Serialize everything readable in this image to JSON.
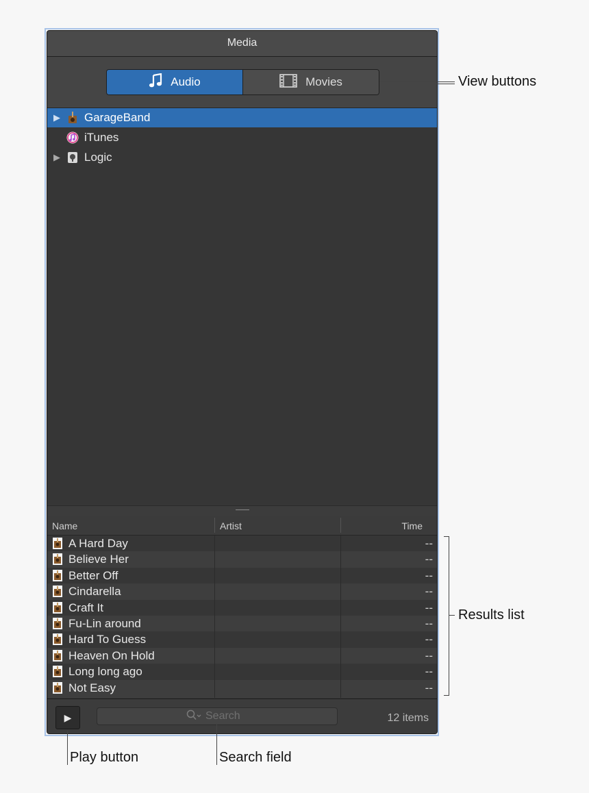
{
  "window": {
    "title": "Media"
  },
  "view_buttons": [
    {
      "label": "Audio",
      "icon": "music-note-icon",
      "active": true
    },
    {
      "label": "Movies",
      "icon": "film-icon",
      "active": false
    }
  ],
  "tree": [
    {
      "label": "GarageBand",
      "icon": "garageband-icon",
      "expandable": true,
      "selected": true
    },
    {
      "label": "iTunes",
      "icon": "itunes-icon",
      "expandable": false,
      "selected": false
    },
    {
      "label": "Logic",
      "icon": "logic-icon",
      "expandable": true,
      "selected": false
    }
  ],
  "columns": {
    "name": "Name",
    "artist": "Artist",
    "time": "Time"
  },
  "results": [
    {
      "name": "A Hard Day",
      "artist": "",
      "time": "--"
    },
    {
      "name": "Believe Her",
      "artist": "",
      "time": "--"
    },
    {
      "name": "Better Off",
      "artist": "",
      "time": "--"
    },
    {
      "name": "Cindarella",
      "artist": "",
      "time": "--"
    },
    {
      "name": "Craft It",
      "artist": "",
      "time": "--"
    },
    {
      "name": "Fu-Lin around",
      "artist": "",
      "time": "--"
    },
    {
      "name": "Hard To Guess",
      "artist": "",
      "time": "--"
    },
    {
      "name": "Heaven On Hold",
      "artist": "",
      "time": "--"
    },
    {
      "name": "Long long ago",
      "artist": "",
      "time": "--"
    },
    {
      "name": "Not Easy",
      "artist": "",
      "time": "--"
    }
  ],
  "footer": {
    "play_label": "▶",
    "search_placeholder": "Search",
    "count_label": "12 items"
  },
  "callouts": {
    "view_buttons": "View buttons",
    "results_list": "Results list",
    "play_button": "Play button",
    "search_field": "Search field"
  },
  "colors": {
    "accent": "#2e6eb3",
    "panel": "#363636",
    "frame": "#a9c4e8"
  }
}
